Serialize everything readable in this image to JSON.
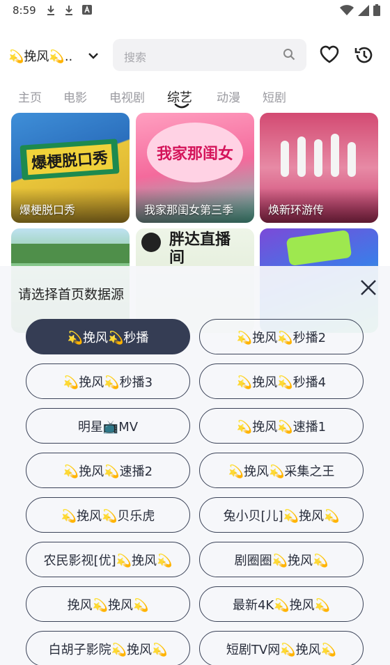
{
  "status_bar": {
    "time": "8:59",
    "left_icons": [
      "download-icon",
      "download-icon",
      "font-icon"
    ],
    "right_icons": [
      "wifi-icon",
      "signal-icon",
      "battery-icon"
    ]
  },
  "header": {
    "source_name": "💫挽风💫..",
    "search_placeholder": "搜索"
  },
  "tabs": [
    {
      "label": "主页",
      "active": false
    },
    {
      "label": "电影",
      "active": false
    },
    {
      "label": "电视剧",
      "active": false
    },
    {
      "label": "综艺",
      "active": true
    },
    {
      "label": "动漫",
      "active": false
    },
    {
      "label": "短剧",
      "active": false
    }
  ],
  "cards": [
    {
      "title": "爆梗脱口秀",
      "poster_text": "爆梗脱口秀"
    },
    {
      "title": "我家那闺女第三季",
      "poster_text": "我家那闺女"
    },
    {
      "title": "焕新环游传",
      "poster_text": ""
    },
    {
      "title": "",
      "poster_text": ""
    },
    {
      "title": "",
      "poster_text": "胖达直播间"
    },
    {
      "title": "",
      "poster_text": ""
    }
  ],
  "source_panel": {
    "title": "请选择首页数据源",
    "options": [
      {
        "label": "💫挽风💫秒播",
        "selected": true
      },
      {
        "label": "💫挽风💫秒播2",
        "selected": false
      },
      {
        "label": "💫挽风💫秒播3",
        "selected": false
      },
      {
        "label": "💫挽风💫秒播4",
        "selected": false
      },
      {
        "label": "明星📺MV",
        "selected": false
      },
      {
        "label": "💫挽风💫速播1",
        "selected": false
      },
      {
        "label": "💫挽风💫速播2",
        "selected": false
      },
      {
        "label": "💫挽风💫采集之王",
        "selected": false
      },
      {
        "label": "💫挽风💫贝乐虎",
        "selected": false
      },
      {
        "label": "兔小贝[儿]💫挽风💫",
        "selected": false
      },
      {
        "label": "农民影视[优]💫挽风💫",
        "selected": false
      },
      {
        "label": "剧圈圈💫挽风💫",
        "selected": false
      },
      {
        "label": "挽风💫挽风💫",
        "selected": false
      },
      {
        "label": "最新4K💫挽风💫",
        "selected": false
      },
      {
        "label": "白胡子影院💫挽风💫",
        "selected": false
      },
      {
        "label": "短剧TV网💫挽风💫",
        "selected": false
      }
    ]
  },
  "colors": {
    "accent_dark": "#353d54",
    "tab_inactive": "#9a9aa0",
    "overlay_bg": "#f5f6fa"
  }
}
